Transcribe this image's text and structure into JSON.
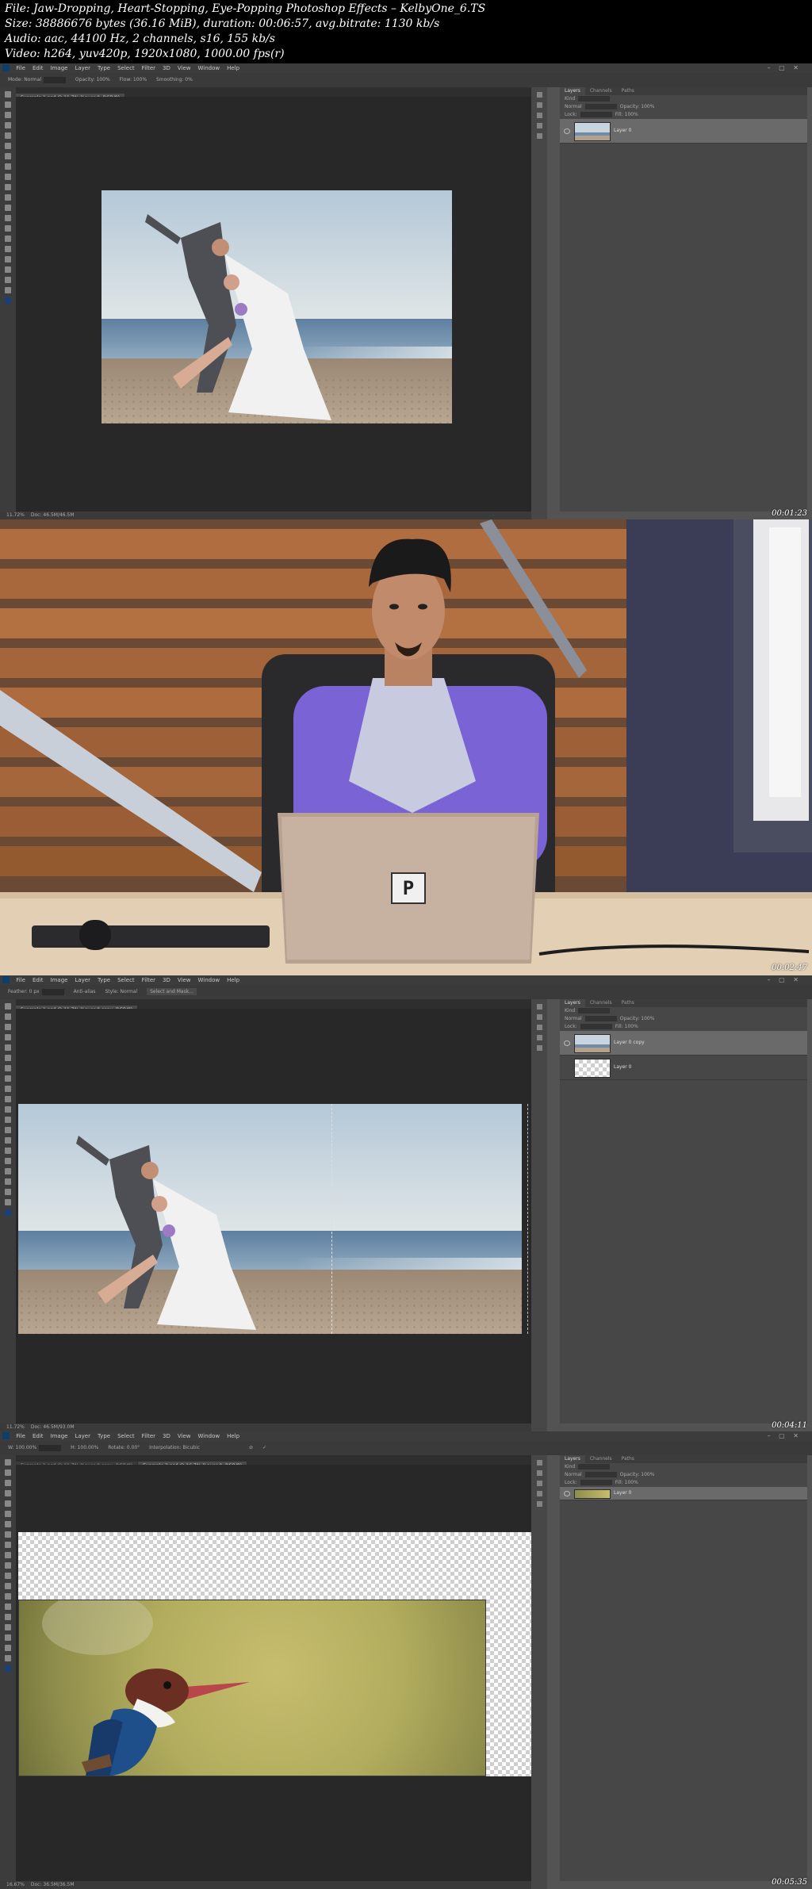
{
  "header": {
    "line1": "File: Jaw-Dropping, Heart-Stopping, Eye-Popping Photoshop Effects – KelbyOne_6.TS",
    "line2": "Size: 38886676 bytes (36.16 MiB), duration: 00:06:57, avg.bitrate: 1130 kb/s",
    "line3": "Audio: aac, 44100 Hz, 2 channels, s16, 155 kb/s",
    "line4": "Video: h264, yuv420p, 1920x1080, 1000.00 fps(r)"
  },
  "menu": [
    "File",
    "Edit",
    "Image",
    "Layer",
    "Type",
    "Select",
    "Filter",
    "3D",
    "View",
    "Window",
    "Help"
  ],
  "frames": [
    {
      "timestamp": "00:01:23",
      "options": [
        "Mode: Normal",
        "Opacity: 100%",
        "Flow: 100%",
        "Smoothing: 0%"
      ],
      "tabs": [
        "Example 1.psd @ 11.7% (Layer 0, RGB/8)"
      ],
      "status": "11.72%",
      "status2": "Doc: 46.5M/46.5M",
      "panel_tabs": [
        "Layers",
        "Channels",
        "Paths"
      ],
      "panel_rows": [
        "Kind",
        "Normal",
        "Opacity: 100%",
        "Lock:",
        "Fill: 100%"
      ],
      "layers": [
        {
          "name": "Layer 0"
        }
      ]
    },
    {
      "timestamp": "00:02:47",
      "laptop_logo": "P"
    },
    {
      "timestamp": "00:04:11",
      "options": [
        "Feather: 0 px",
        "Anti-alias",
        "Style: Normal",
        "Select and Mask..."
      ],
      "tabs": [
        "Example 1.psd @ 11.7% (Layer 0 copy, RGB/8)"
      ],
      "status": "11.72%",
      "status2": "Doc: 46.5M/93.0M",
      "panel_tabs": [
        "Layers",
        "Channels",
        "Paths"
      ],
      "panel_rows": [
        "Kind",
        "Normal",
        "Opacity: 100%",
        "Lock:",
        "Fill: 100%"
      ],
      "layers": [
        {
          "name": "Layer 0 copy"
        },
        {
          "name": "Layer 0"
        }
      ]
    },
    {
      "timestamp": "00:05:35",
      "options": [
        "W: 100.00%",
        "H: 100.00%",
        "Rotate: 0.00°",
        "Interpolation: Bicubic"
      ],
      "tabs": [
        "Example 1.psd @ 11.7% (Layer 0 copy, RGB/8)",
        "Example 2.psd @ 16.7% (Layer 0, RGB/8)"
      ],
      "status": "16.67%",
      "status2": "Doc: 36.5M/36.5M",
      "panel_tabs": [
        "Layers",
        "Channels",
        "Paths"
      ],
      "panel_rows": [
        "Kind",
        "Normal",
        "Opacity: 100%",
        "Lock:",
        "Fill: 100%"
      ],
      "layers": [
        {
          "name": "Layer 0"
        }
      ]
    }
  ]
}
